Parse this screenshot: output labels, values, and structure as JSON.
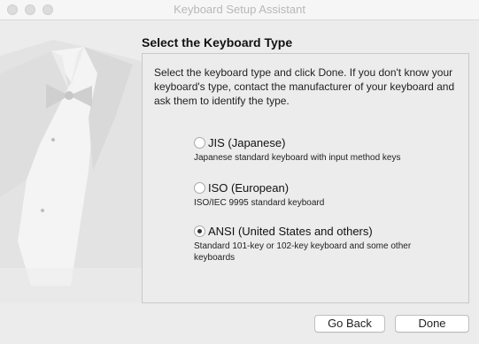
{
  "window": {
    "title": "Keyboard Setup Assistant"
  },
  "page": {
    "heading": "Select the Keyboard Type",
    "instructions": "Select the keyboard type and click Done. If you don't know your keyboard's type, contact the manufacturer of your keyboard and ask them to identify the type."
  },
  "options": [
    {
      "label": "JIS (Japanese)",
      "description": "Japanese standard keyboard with input method keys",
      "selected": false
    },
    {
      "label": "ISO (European)",
      "description": "ISO/IEC 9995 standard keyboard",
      "selected": false
    },
    {
      "label": "ANSI (United States and others)",
      "description": "Standard 101-key or 102-key keyboard and some other keyboards",
      "selected": true
    }
  ],
  "buttons": {
    "back": "Go Back",
    "done": "Done"
  }
}
